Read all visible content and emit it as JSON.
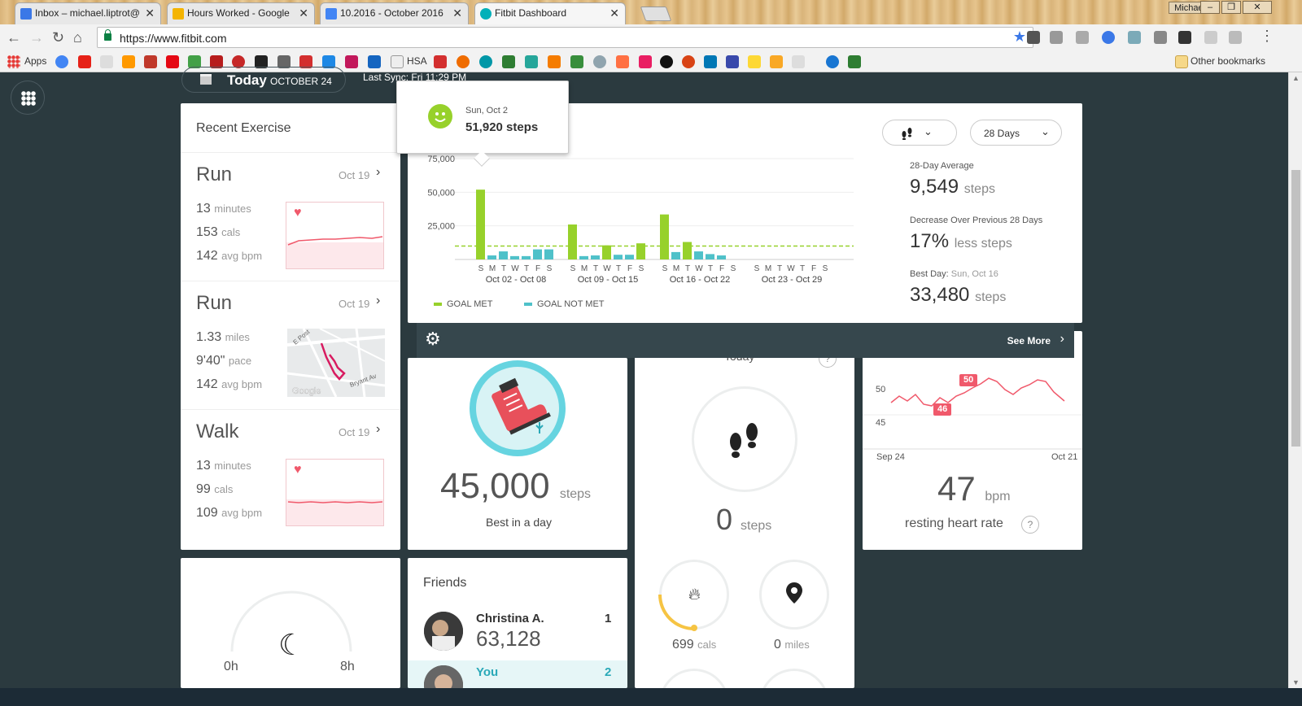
{
  "browser": {
    "tabs": [
      {
        "title": "Inbox – michael.liptrot@",
        "color": "#3b78e7"
      },
      {
        "title": "Hours Worked - Google",
        "color": "#f4b400"
      },
      {
        "title": "10.2016 - October 2016",
        "color": "#4285f4"
      },
      {
        "title": "Fitbit Dashboard",
        "color": "#00b0b9"
      }
    ],
    "tab_close": "✕",
    "profile_name": "Michael",
    "url": "https://www.fitbit.com",
    "bookmarks": {
      "apps_label": "Apps",
      "hsa_label": "HSA",
      "other_label": "Other bookmarks"
    }
  },
  "header": {
    "today_label": "Today",
    "date_label": "OCTOBER 24",
    "last_sync": "Last Sync: Fri 11:29 PM"
  },
  "recent_exercise": {
    "title": "Recent Exercise",
    "items": [
      {
        "name": "Run",
        "date": "Oct 19",
        "stats": [
          {
            "value": "13",
            "unit": "minutes"
          },
          {
            "value": "153",
            "unit": "cals"
          },
          {
            "value": "142",
            "unit": "avg bpm"
          }
        ]
      },
      {
        "name": "Run",
        "date": "Oct 19",
        "stats": [
          {
            "value": "1.33",
            "unit": "miles"
          },
          {
            "value": "9'40\"",
            "unit": "pace"
          },
          {
            "value": "142",
            "unit": "avg bpm"
          }
        ],
        "map_labels": {
          "street1": "E Post",
          "street2": "Bryant Av",
          "brand": "Google"
        }
      },
      {
        "name": "Walk",
        "date": "Oct 19",
        "stats": [
          {
            "value": "13",
            "unit": "minutes"
          },
          {
            "value": "99",
            "unit": "cals"
          },
          {
            "value": "109",
            "unit": "avg bpm"
          }
        ]
      }
    ]
  },
  "steps_chart": {
    "tooltip": {
      "date": "Sun, Oct 2",
      "value": "51,920 steps"
    },
    "range_label": "28 Days",
    "stats": {
      "average_label": "28-Day Average",
      "average_value": "9,549",
      "average_unit": "steps",
      "decrease_label": "Decrease Over Previous 28 Days",
      "decrease_value": "17%",
      "decrease_unit": "less steps",
      "best_label": "Best Day:",
      "best_date": "Sun, Oct 16",
      "best_value": "33,480",
      "best_unit": "steps"
    },
    "legend": {
      "met": "GOAL MET",
      "not_met": "GOAL NOT MET"
    },
    "see_more": "See More",
    "colors": {
      "met": "#97d12b",
      "not_met": "#4fc1c9",
      "goal": "#97d12b"
    }
  },
  "chart_data": {
    "type": "bar",
    "title": "",
    "xlabel": "",
    "ylabel": "",
    "ylim": [
      0,
      75000
    ],
    "yticks": [
      "75,000",
      "50,000",
      "25,000"
    ],
    "ytick_values": [
      75000,
      50000,
      25000
    ],
    "goal": 10000,
    "weeks": [
      "Oct 02 - Oct 08",
      "Oct 09 - Oct 15",
      "Oct 16 - Oct 22",
      "Oct 23 - Oct 29"
    ],
    "day_letters": [
      "S",
      "M",
      "T",
      "W",
      "T",
      "F",
      "S"
    ],
    "series": [
      {
        "name": "",
        "values": [
          51920,
          3000,
          6000,
          2500,
          2500,
          7500,
          7500,
          26000,
          2500,
          3000,
          10500,
          3500,
          3500,
          12000,
          33480,
          5500,
          13000,
          6000,
          4000,
          3000,
          0,
          0,
          0,
          0,
          0,
          0,
          0,
          0
        ],
        "goal_met": [
          true,
          false,
          false,
          false,
          false,
          false,
          false,
          true,
          false,
          false,
          true,
          false,
          false,
          true,
          true,
          false,
          true,
          false,
          false,
          false,
          false,
          false,
          false,
          false,
          false,
          false,
          false,
          false
        ]
      }
    ]
  },
  "best_day_card": {
    "value": "45,000",
    "unit": "steps",
    "label": "Best in a day"
  },
  "today_steps": {
    "heading": "Today",
    "help": "?",
    "value": "0",
    "unit": "steps",
    "cals_value": "699",
    "cals_unit": "cals",
    "miles_value": "0",
    "miles_unit": "miles"
  },
  "heart_rate": {
    "y_high": "50",
    "y_low": "45",
    "peak_label": "50",
    "low_label": "46",
    "x_start": "Sep 24",
    "x_end": "Oct 21",
    "value": "47",
    "unit": "bpm",
    "label": "resting heart rate",
    "help": "?"
  },
  "sleep": {
    "min_label": "0h",
    "max_label": "8h"
  },
  "friends": {
    "title": "Friends",
    "items": [
      {
        "rank": "1",
        "name": "Christina A.",
        "steps": "63,128"
      },
      {
        "rank": "2",
        "name": "You",
        "steps": ""
      }
    ]
  }
}
